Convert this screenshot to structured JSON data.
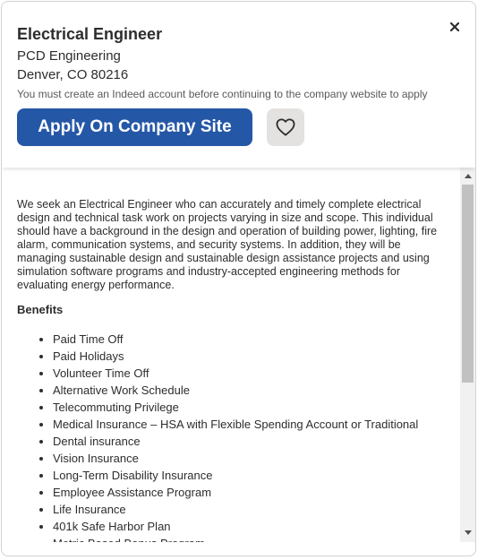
{
  "header": {
    "job_title": "Electrical Engineer",
    "company": "PCD Engineering",
    "location": "Denver, CO 80216",
    "notice": "You must create an Indeed account before continuing to the company website to apply",
    "apply_label": "Apply On Company Site",
    "save_icon": "heart-outline-icon",
    "close_icon": "close-icon"
  },
  "description": {
    "text": "We seek an Electrical Engineer who can accurately and timely complete electrical design and technical task work on projects varying in size and scope. This individual should have a background in the design and operation of building power, lighting, fire alarm, communication systems, and security systems. In addition, they will be managing sustainable design and sustainable design assistance projects and using simulation software programs and industry-accepted engineering methods for evaluating energy performance."
  },
  "benefits": {
    "heading": "Benefits",
    "items": [
      "Paid Time Off",
      "Paid Holidays",
      "Volunteer Time Off",
      "Alternative Work Schedule",
      "Telecommuting Privilege",
      "Medical Insurance – HSA with Flexible Spending Account or Traditional",
      "Dental insurance",
      "Vision Insurance",
      "Long-Term Disability Insurance",
      "Employee Assistance Program",
      "Life Insurance",
      "401k Safe Harbor Plan",
      "Metric Based Bonus Program"
    ]
  },
  "colors": {
    "accent": "#2557a7",
    "text": "#2d2d2d",
    "muted": "#595959",
    "save_bg": "#e4e2e0"
  }
}
